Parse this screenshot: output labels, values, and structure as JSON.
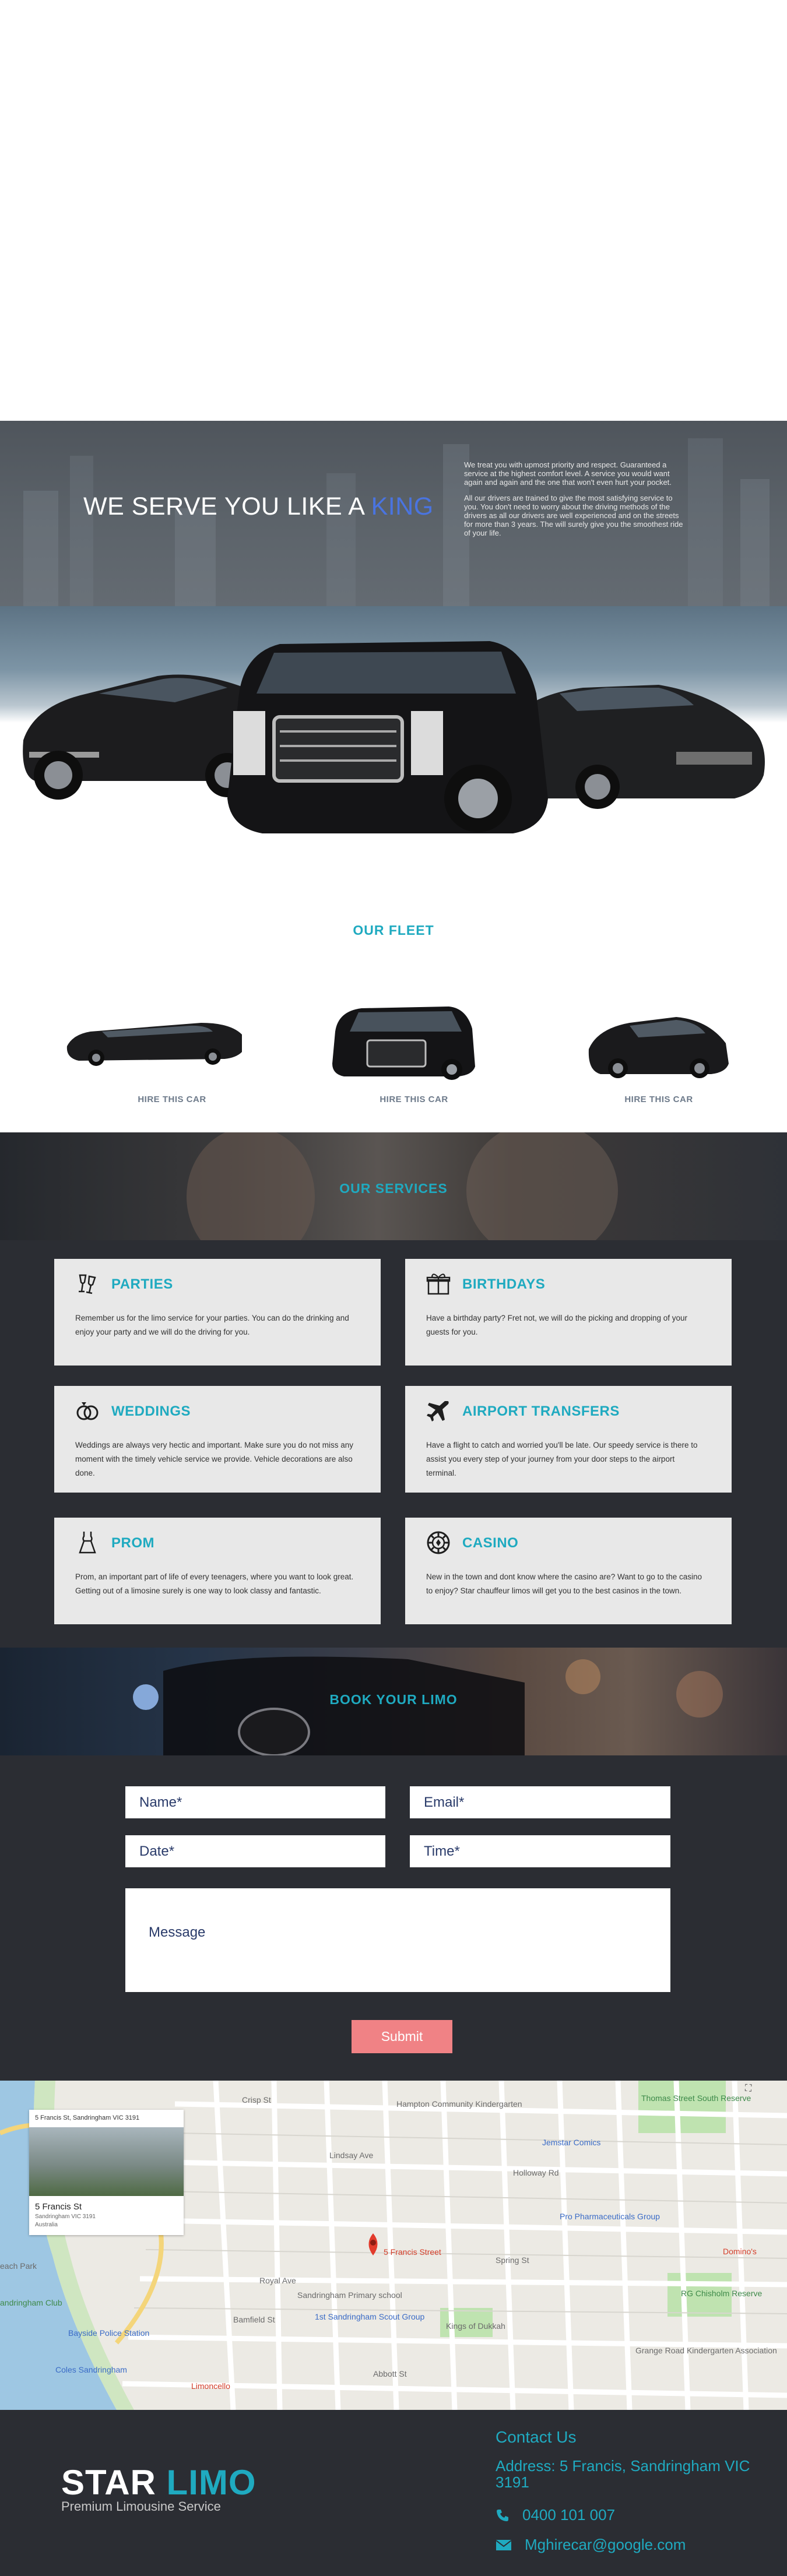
{
  "hero": {
    "title_main": "WE SERVE YOU LIKE A ",
    "title_accent": "KING",
    "paragraph_1": "We treat you with upmost priority and respect. Guaranteed a service at the highest comfort level. A service you would want again and again and the one that won't even hurt your pocket.",
    "paragraph_2": "All our drivers are trained to give the most satisfying service to you. You don't need to worry about the driving methods of the drivers as all our drivers are well experienced and on the streets for more than 3 years. The will surely give you the smoothest ride of your life."
  },
  "fleet": {
    "title": "OUR FLEET",
    "cards": [
      {
        "link": "HIRE THIS CAR"
      },
      {
        "link": "HIRE THIS CAR"
      },
      {
        "link": "HIRE THIS CAR"
      }
    ]
  },
  "services": {
    "title": "OUR SERVICES",
    "items": [
      {
        "icon": "champagne-glasses-icon",
        "title": "PARTIES",
        "text": "Remember us for the limo service for your parties. You can do the drinking and enjoy your party and we will do the driving for you."
      },
      {
        "icon": "gift-box-icon",
        "title": "BIRTHDAYS",
        "text": "Have a birthday party? Fret not, we will do the picking and dropping of your guests for you."
      },
      {
        "icon": "wedding-rings-icon",
        "title": "WEDDINGS",
        "text": "Weddings are always very hectic and important. Make sure you do not miss any moment with the timely vehicle service we provide. Vehicle decorations are also done."
      },
      {
        "icon": "airplane-icon",
        "title": "AIRPORT TRANSFERS",
        "text": "Have a flight to catch and worried you'll be late. Our speedy service is there to assist you every step of your journey from your door steps to the airport terminal."
      },
      {
        "icon": "dress-icon",
        "title": "PROM",
        "text": "Prom, an important part of life of every teenagers, where you want to look great. Getting out of a limosine surely is one way to look classy and fantastic."
      },
      {
        "icon": "casino-chip-icon",
        "title": "CASINO",
        "text": "New in the town and dont know where the casino are? Want to go to the casino to enjoy? Star chauffeur limos will get you to the best casinos in the town."
      }
    ]
  },
  "booking": {
    "title": "BOOK YOUR LIMO",
    "name_placeholder": "Name*",
    "email_placeholder": "Email*",
    "date_placeholder": "Date*",
    "time_placeholder": "Time*",
    "message_placeholder": "Message",
    "submit_label": "Submit"
  },
  "map": {
    "card_title": "5 Francis St",
    "card_subtitle": "Sandringham VIC 3191",
    "card_line": "Sandringham VIC 3191",
    "card_country": "Australia",
    "marker_label": "5 Francis Street",
    "labels": {
      "hampton": "Hampton Community Kindergarten",
      "thomas": "Thomas Street South Reserve",
      "jemstar": "Jemstar Comics",
      "pro_pharm": "Pro Pharmaceuticals Group",
      "dominos": "Domino's",
      "rg": "RG Chisholm Reserve",
      "primary": "Sandringham Primary school",
      "scout": "1st Sandringham Scout Group",
      "dukkah": "Kings of Dukkah",
      "grange": "Grange Road Kindergarten Association",
      "club": "andringham Club",
      "beach": "each Park",
      "police": "Bayside Police Station",
      "coles": "Coles Sandringham",
      "limoncello": "Limoncello",
      "abbott": "Abbott St",
      "crisp": "Crisp St",
      "lindsay": "Lindsay Ave",
      "bamfield": "Bamfield St",
      "spring": "Spring St",
      "royal": "Royal Ave",
      "holloway": "Holloway Rd"
    }
  },
  "footer": {
    "logo_main": "STAR ",
    "logo_accent": "LIMO",
    "logo_sub": "Premium Limousine Service",
    "contact_title": "Contact Us",
    "address": "Address: 5 Francis, Sandringham VIC 3191",
    "phone": "0400 101 007",
    "email": "Mghirecar@google.com"
  }
}
